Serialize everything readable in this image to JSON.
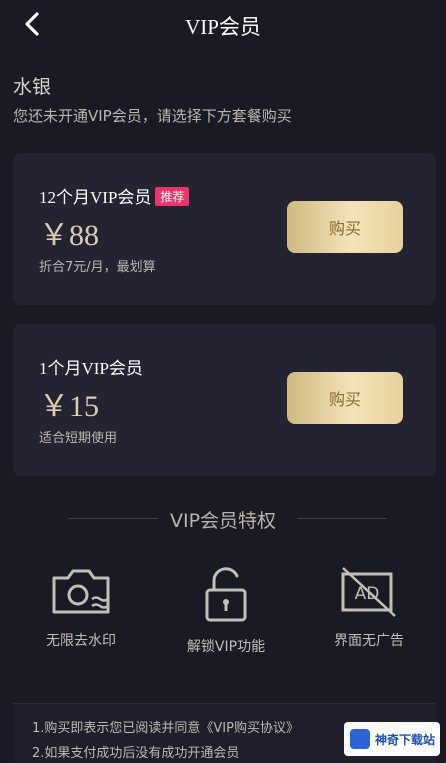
{
  "header": {
    "title": "VIP会员",
    "back_icon": "chevron-left-icon"
  },
  "user": {
    "name": "水银",
    "tip": "您还未开通VIP会员，请选择下方套餐购买"
  },
  "plans": [
    {
      "name": "12个月VIP会员",
      "badge": "推荐",
      "price": "￥88",
      "desc": "折合7元/月，最划算",
      "buy_label": "购买"
    },
    {
      "name": "1个月VIP会员",
      "price": "￥15",
      "desc": "适合短期使用",
      "buy_label": "购买"
    }
  ],
  "privileges": {
    "title": "VIP会员特权",
    "items": [
      {
        "label": "无限去水印",
        "icon": "camera-icon"
      },
      {
        "label": "解锁VIP功能",
        "icon": "unlock-icon"
      },
      {
        "label": "界面无广告",
        "icon": "ad-icon"
      }
    ]
  },
  "notice": {
    "line1": "1.购买即表示您已阅读并同意《VIP购买协议》",
    "line2": "2.如果支付成功后没有成功开通会员"
  },
  "watermark": {
    "text": "神奇下载站"
  },
  "colors": {
    "background": "#1a1a24",
    "card": "#232331",
    "gold": "#e8d5a3",
    "badge": "#e9356b"
  }
}
